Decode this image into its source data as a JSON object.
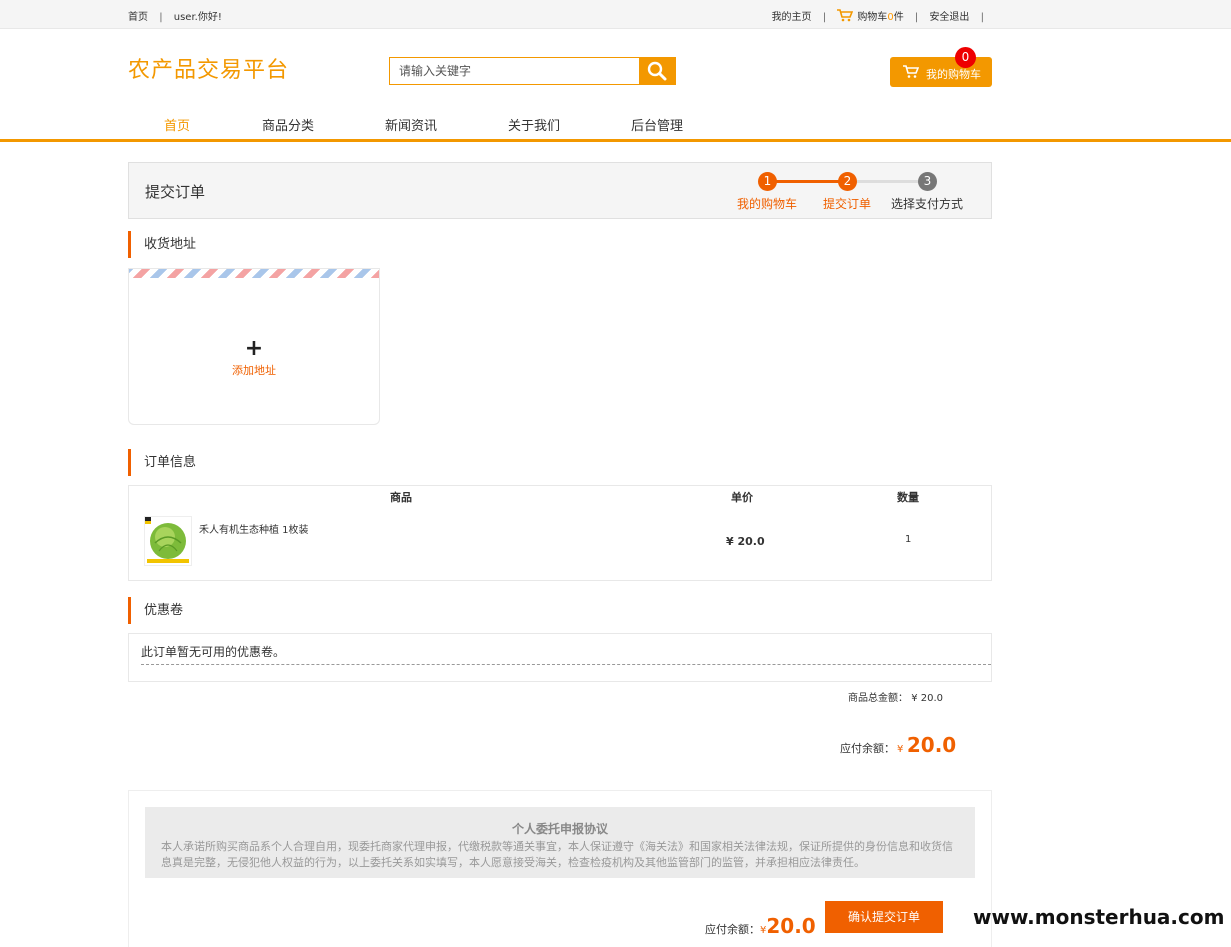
{
  "colors": {
    "brand": "#f39800",
    "accent": "#f06000",
    "badge": "#e00000",
    "step_inactive": "#888888"
  },
  "topbar": {
    "home": "首页",
    "greeting": "user.你好!",
    "my_home": "我的主页",
    "cart_prefix": "购物车",
    "cart_count": "0",
    "cart_suffix": "件",
    "logout": "安全退出",
    "sep": "|"
  },
  "header": {
    "logo": "农产品交易平台",
    "search_placeholder": "请输入关键字",
    "my_cart_label": "我的购物车",
    "cart_badge": "0"
  },
  "nav": [
    "首页",
    "商品分类",
    "新闻资讯",
    "关于我们",
    "后台管理"
  ],
  "steps": {
    "title": "提交订单",
    "items": [
      {
        "num": "1",
        "label": "我的购物车"
      },
      {
        "num": "2",
        "label": "提交订单"
      },
      {
        "num": "3",
        "label": "选择支付方式"
      }
    ],
    "current": 2
  },
  "address": {
    "title": "收货地址",
    "add_symbol": "+",
    "add_label": "添加地址"
  },
  "order": {
    "title": "订单信息",
    "headers": [
      "商品",
      "单价",
      "数量"
    ],
    "items": [
      {
        "name": "禾人有机生态种植 1枚装",
        "price": "¥ 20.0",
        "qty": "1",
        "image_icon": "cabbage-image"
      }
    ]
  },
  "coupon": {
    "title": "优惠卷",
    "text": "此订单暂无可用的优惠卷。"
  },
  "totals": {
    "goods_total_label": "商品总金额：",
    "goods_total_value": "¥ 20.0",
    "payable_label": "应付余额：",
    "currency": "¥",
    "payable_value": "20.0"
  },
  "agreement": {
    "title": "个人委托申报协议",
    "body": "本人承诺所购买商品系个人合理自用，现委托商家代理申报，代缴税款等通关事宜，本人保证遵守《海关法》和国家相关法律法规，保证所提供的身份信息和收货信息真是完整，无侵犯他人权益的行为，以上委托关系如实填写，本人愿意接受海关，检查检疫机构及其他监管部门的监管，并承担相应法律责任。"
  },
  "bottom": {
    "payable_label": "应付余额：",
    "currency": "¥",
    "payable_value": "20.0",
    "confirm_button": "确认提交订单",
    "watermark": "www.monsterhua.com"
  }
}
